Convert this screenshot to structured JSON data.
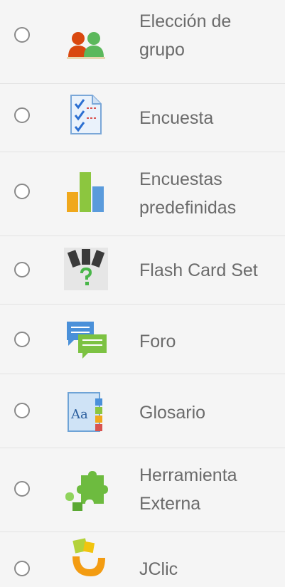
{
  "activities": [
    {
      "label": "Elección de\ngrupo",
      "icon": "group-choice-icon"
    },
    {
      "label": "Encuesta",
      "icon": "survey-icon"
    },
    {
      "label": "Encuestas\npredefinidas",
      "icon": "bar-chart-icon"
    },
    {
      "label": "Flash Card Set",
      "icon": "flash-cards-icon"
    },
    {
      "label": "Foro",
      "icon": "forum-icon"
    },
    {
      "label": "Glosario",
      "icon": "glossary-icon"
    },
    {
      "label": "Herramienta\nExterna",
      "icon": "puzzle-icon"
    },
    {
      "label": "JClic",
      "icon": "jclic-icon"
    }
  ]
}
